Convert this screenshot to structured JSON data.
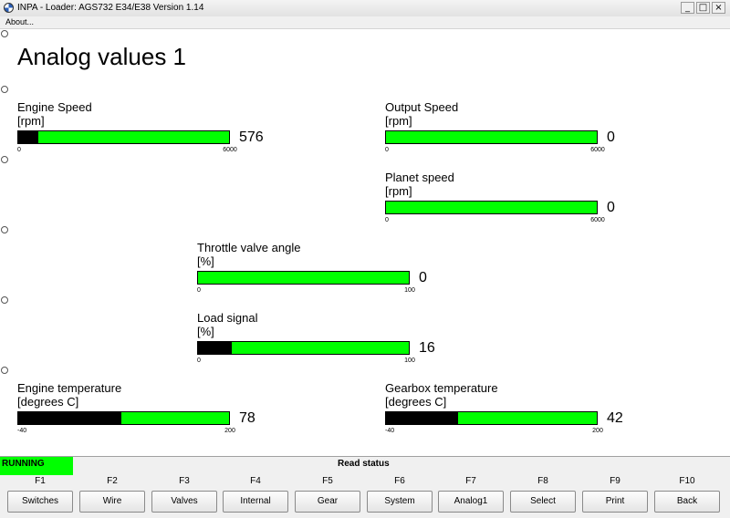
{
  "window": {
    "title": "INPA - Loader:  AGS732 E34/E38 Version 1.14",
    "app_icon": "bmw-logo-icon",
    "controls": {
      "minimize": "_",
      "maximize": "□",
      "close": "×"
    }
  },
  "menu": {
    "about": "About..."
  },
  "page": {
    "title": "Analog values 1"
  },
  "gauges": {
    "engine_speed": {
      "label": "Engine Speed",
      "unit": "[rpm]",
      "min": "0",
      "max": "6000",
      "value": "576",
      "fill_fraction": 0.096
    },
    "output_speed": {
      "label": "Output Speed",
      "unit": "[rpm]",
      "min": "0",
      "max": "6000",
      "value": "0",
      "fill_fraction": 0
    },
    "planet_speed": {
      "label": "Planet speed",
      "unit": "[rpm]",
      "min": "0",
      "max": "6000",
      "value": "0",
      "fill_fraction": 0
    },
    "throttle": {
      "label": "Throttle valve angle",
      "unit": "[%]",
      "min": "0",
      "max": "100",
      "value": "0",
      "fill_fraction": 0
    },
    "load_signal": {
      "label": "Load signal",
      "unit": "[%]",
      "min": "0",
      "max": "100",
      "value": "16",
      "fill_fraction": 0.16
    },
    "engine_temperature": {
      "label": "Engine temperature",
      "unit": "[degrees C]",
      "min": "-40",
      "max": "200",
      "value": "78",
      "fill_fraction": 0.49
    },
    "gearbox_temperature": {
      "label": "Gearbox temperature",
      "unit": "[degrees C]",
      "min": "-40",
      "max": "200",
      "value": "42",
      "fill_fraction": 0.34
    }
  },
  "status": {
    "running": "RUNNING",
    "read_status": "Read status"
  },
  "fkeys": [
    {
      "key": "F1",
      "label": "Switches"
    },
    {
      "key": "F2",
      "label": "Wire"
    },
    {
      "key": "F3",
      "label": "Valves"
    },
    {
      "key": "F4",
      "label": "Internal"
    },
    {
      "key": "F5",
      "label": "Gear"
    },
    {
      "key": "F6",
      "label": "System"
    },
    {
      "key": "F7",
      "label": "Analog1"
    },
    {
      "key": "F8",
      "label": "Select"
    },
    {
      "key": "F9",
      "label": "Print"
    },
    {
      "key": "F10",
      "label": "Back"
    }
  ],
  "colors": {
    "bar_fill": "#00ff00",
    "bar_value": "#000000",
    "running_badge": "#00ff00"
  }
}
